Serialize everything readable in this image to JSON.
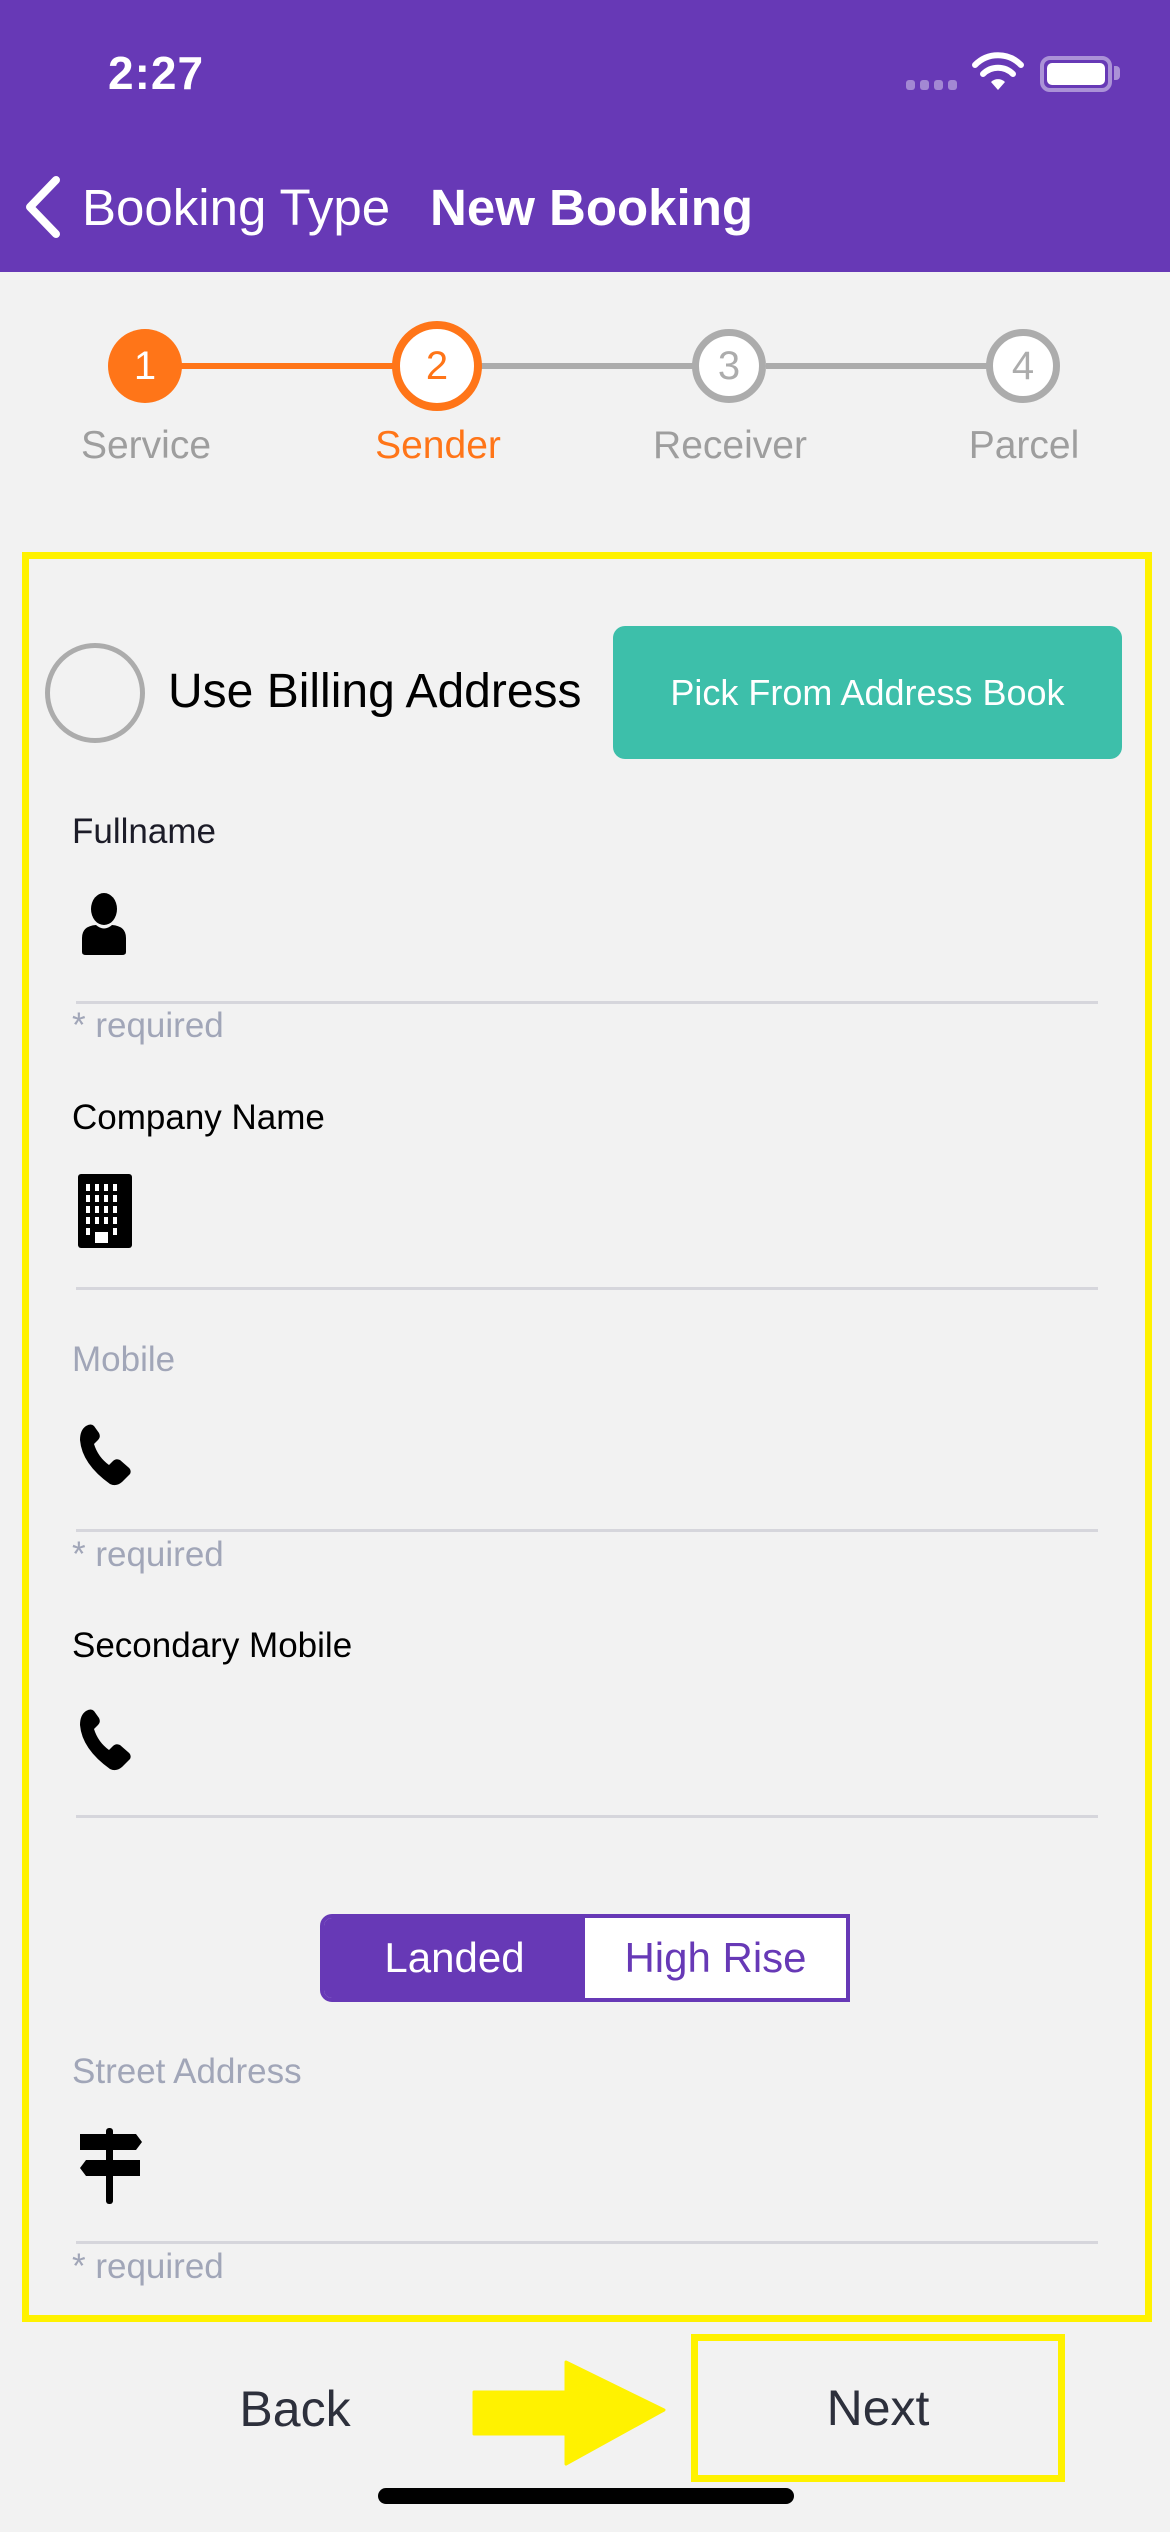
{
  "status_bar": {
    "time": "2:27"
  },
  "nav": {
    "back_label": "Booking Type",
    "title": "New Booking"
  },
  "stepper": {
    "current_step": 2,
    "steps": [
      {
        "number": "1",
        "label": "Service",
        "state": "completed"
      },
      {
        "number": "2",
        "label": "Sender",
        "state": "active"
      },
      {
        "number": "3",
        "label": "Receiver",
        "state": "pending"
      },
      {
        "number": "4",
        "label": "Parcel",
        "state": "pending"
      }
    ]
  },
  "form": {
    "use_billing_address": {
      "label": "Use Billing Address",
      "checked": false
    },
    "pick_address_button": "Pick From Address Book",
    "fields": [
      {
        "label": "Fullname",
        "icon": "person-icon",
        "value": "",
        "helper": "* required"
      },
      {
        "label": "Company Name",
        "icon": "building-icon",
        "value": "",
        "helper": ""
      },
      {
        "label": "Mobile",
        "icon": "phone-icon",
        "value": "",
        "helper": "* required"
      },
      {
        "label": "Secondary Mobile",
        "icon": "phone-icon",
        "value": "",
        "helper": ""
      }
    ],
    "property_type": {
      "options": [
        "Landed",
        "High Rise"
      ],
      "selected": "Landed"
    },
    "street_address": {
      "label": "Street Address",
      "icon": "signpost-icon",
      "value": "",
      "helper": "* required"
    }
  },
  "footer": {
    "back_label": "Back",
    "next_label": "Next"
  },
  "colors": {
    "brand_purple": "#6739b6",
    "step_orange": "#ff7518",
    "step_gray": "#acacac",
    "teal_button": "#3dbfaa",
    "highlight_yellow": "#fff200"
  }
}
